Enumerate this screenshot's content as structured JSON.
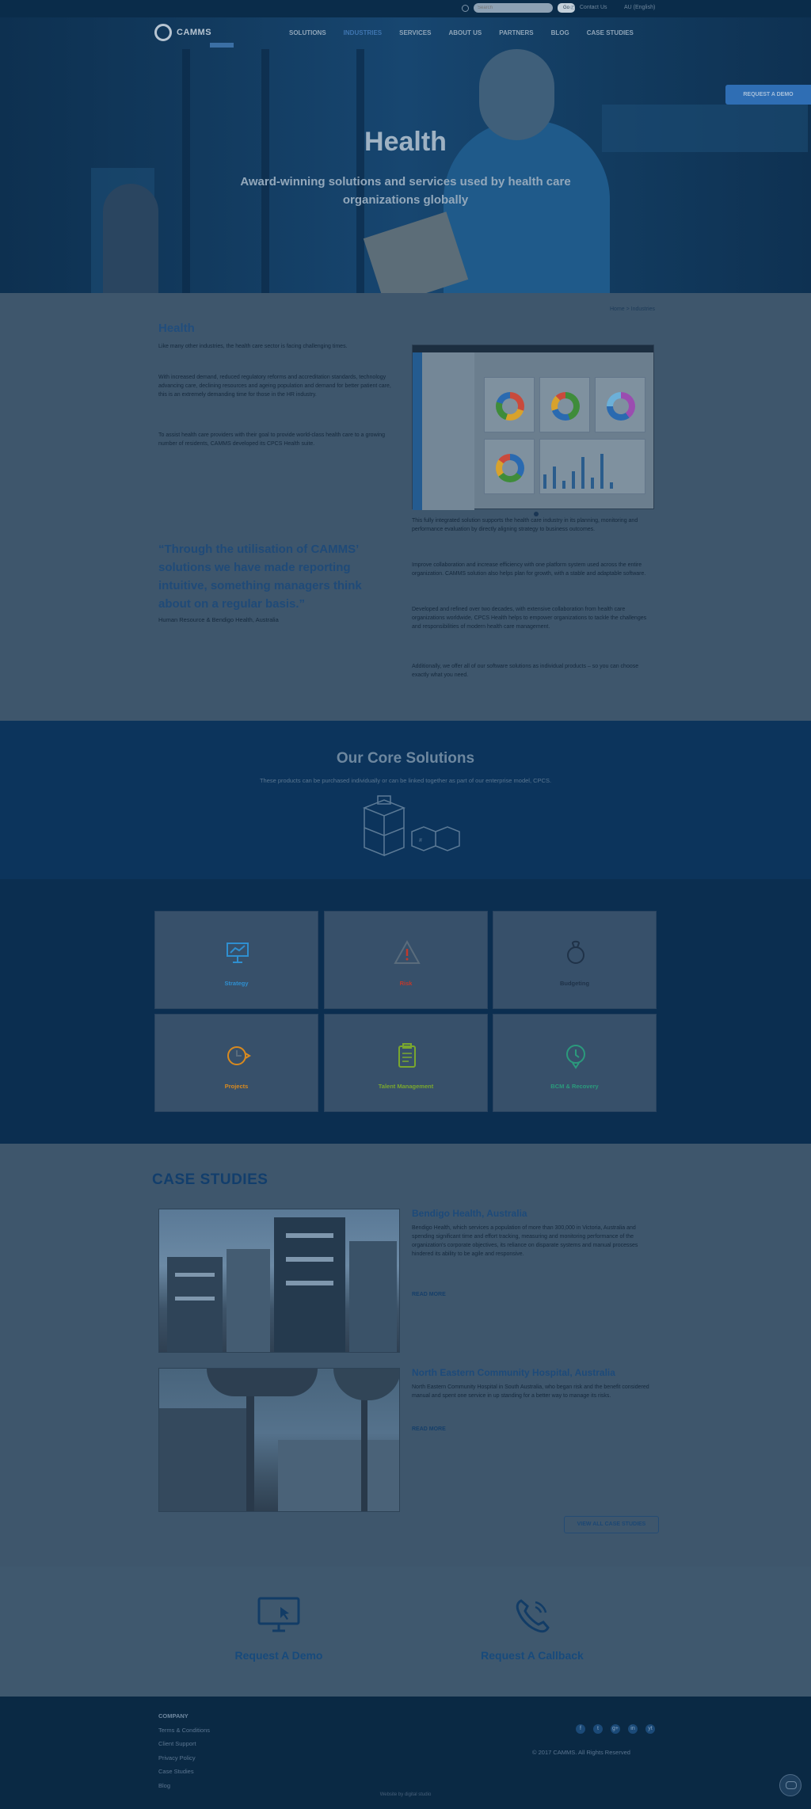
{
  "topbar": {
    "search_placeholder": "Search",
    "search_button": "Go",
    "phone": "Contact Us",
    "region": "AU (English)"
  },
  "nav": {
    "logo": "CAMMS",
    "items": [
      "SOLUTIONS",
      "INDUSTRIES",
      "SERVICES",
      "ABOUT US",
      "PARTNERS",
      "BLOG",
      "CASE STUDIES"
    ],
    "active_index": 1
  },
  "hero": {
    "title": "Health",
    "subtitle": "Award-winning solutions and services used by health care organizations globally",
    "demo_tab": "REQUEST A DEMO"
  },
  "intro": {
    "breadcrumb": "Home > Industries",
    "heading": "Health",
    "left_paragraphs": [
      "Like many other industries, the health care sector is facing challenging times.",
      "With increased demand, reduced regulatory reforms and accreditation standards, technology advancing care, declining resources and ageing population and demand for better patient care, this is an extremely demanding time for those in the HR industry.",
      "To assist health care providers with their goal to provide world-class health care to a growing number of residents, CAMMS developed its CPCS Health suite."
    ],
    "quote": "“Through the utilisation of CAMMS’ solutions we have made reporting intuitive, something managers think about on a regular basis.”",
    "quote_source": "Human Resource & Bendigo Health, Australia",
    "right_paragraphs": [
      "This fully integrated solution supports the health care industry in its planning, monitoring and performance evaluation by directly aligning strategy to business outcomes.",
      "Improve collaboration and increase efficiency with one platform system used across the entire organization. CAMMS solution also helps plan for growth, with a stable and adaptable software.",
      "Developed and refined over two decades, with extensive collaboration from health care organizations worldwide, CPCS Health helps to empower organizations to tackle the challenges and responsibilities of modern health care management.",
      "Additionally, we offer all of our software solutions as individual products – so you can choose exactly what you need."
    ]
  },
  "core": {
    "title": "Our Core Solutions",
    "subtitle": "These products can be purchased individually or can be linked together as part of our enterprise model, CPCS."
  },
  "products": [
    {
      "label": "Strategy",
      "color": "#2f8fd0",
      "icon": "monitor-presentation-icon"
    },
    {
      "label": "Risk",
      "color": "#c0392b",
      "icon": "warning-triangle-icon"
    },
    {
      "label": "Budgeting",
      "color": "#1f3248",
      "icon": "piggy-bank-icon"
    },
    {
      "label": "Projects",
      "color": "#d98a1f",
      "icon": "timeline-icon"
    },
    {
      "label": "Talent Management",
      "color": "#7aa72e",
      "icon": "clipboard-icon"
    },
    {
      "label": "BCM & Recovery",
      "color": "#2b9a7c",
      "icon": "shield-icon"
    }
  ],
  "cases": {
    "heading": "CASE STUDIES",
    "items": [
      {
        "title": "Bendigo Health, Australia",
        "text": "Bendigo Health, which services a population of more than 300,000 in Victoria, Australia and spending significant time and effort tracking, measuring and monitoring performance of the organization's corporate objectives, its reliance on disparate systems and manual processes hindered its ability to be agile and responsive.",
        "more": "READ MORE"
      },
      {
        "title": "North Eastern Community Hospital, Australia",
        "text": "North Eastern Community Hospital in South Australia, who began risk and the benefit considered manual and spent one service in up standing for a better way to manage its risks.",
        "more": "READ MORE"
      }
    ],
    "view_all": "VIEW ALL CASE STUDIES"
  },
  "cta": {
    "demo": "Request A Demo",
    "callback": "Request A Callback"
  },
  "footer": {
    "heading": "COMPANY",
    "links": [
      "Terms & Conditions",
      "Client Support",
      "Privacy Policy",
      "Case Studies",
      "Blog"
    ],
    "social": [
      "f",
      "t",
      "g+",
      "in",
      "yt"
    ],
    "copyright": "© 2017 CAMMS. All Rights Reserved",
    "powered": "Website by digital studio"
  }
}
